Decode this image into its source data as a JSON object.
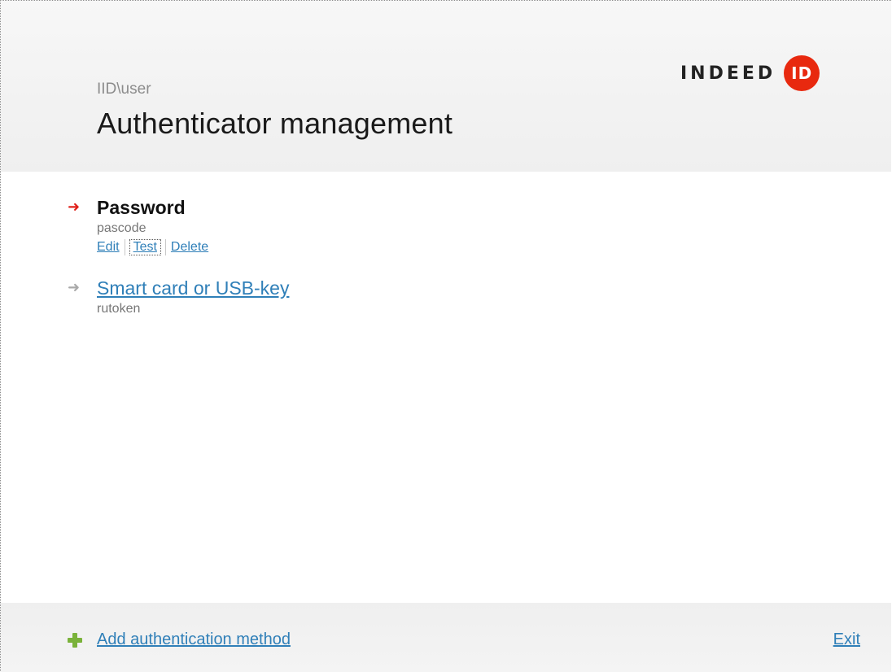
{
  "header": {
    "domain_user": "IID\\user",
    "title": "Authenticator management",
    "logo": {
      "word": "INDEED",
      "badge": "ID",
      "badge_color": "#e8290f"
    }
  },
  "methods": [
    {
      "name": "Password",
      "subtitle": "pascode",
      "active": true,
      "actions": {
        "edit": "Edit",
        "test": "Test",
        "delete": "Delete"
      }
    },
    {
      "name": "Smart card or USB-key",
      "subtitle": "rutoken",
      "active": false
    }
  ],
  "footer": {
    "add_method": "Add authentication method",
    "exit": "Exit"
  },
  "colors": {
    "accent_link": "#2f7fb8",
    "active_arrow": "#e0221b",
    "inactive_arrow": "#a9a9a9",
    "plus_icon": "#7ab23a"
  },
  "icons": {
    "active_arrow": "right-arrow-icon",
    "inactive_arrow": "right-arrow-icon",
    "add": "plus-icon"
  }
}
